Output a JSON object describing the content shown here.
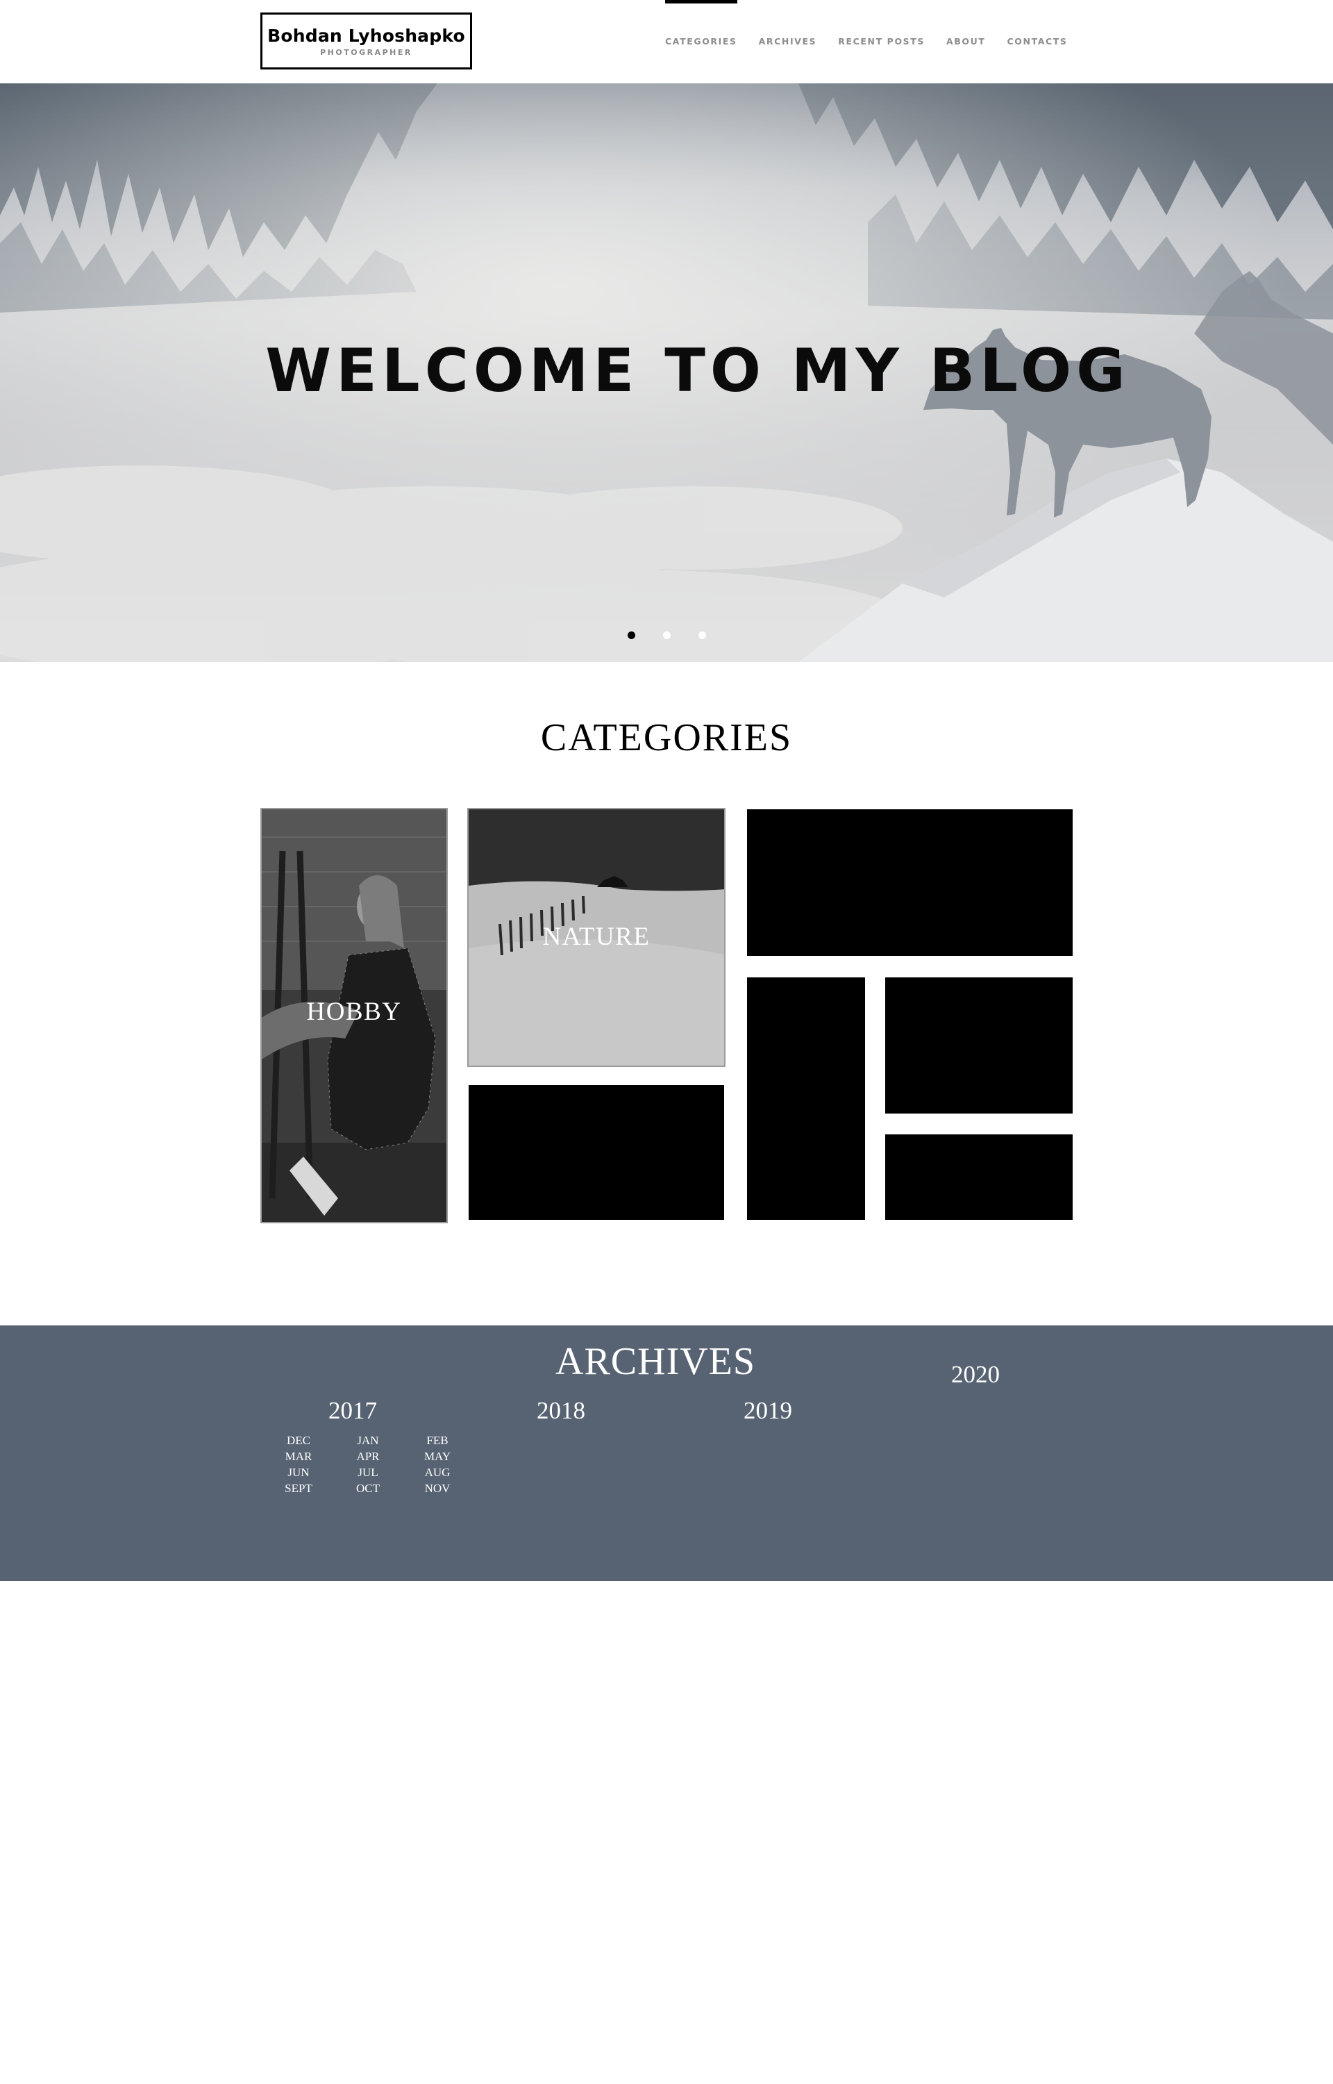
{
  "header": {
    "logo_name": "Bohdan Lyhoshapko",
    "logo_tagline": "PHOTOGRAPHER",
    "nav": [
      "CATEGORIES",
      "ARCHIVES",
      "RECENT POSTS",
      "ABOUT",
      "CONTACTS"
    ],
    "active_nav": "CATEGORIES"
  },
  "hero": {
    "title": "WELCOME TO MY BLOG",
    "slides_count": 3,
    "active_slide": 1
  },
  "categories": {
    "heading": "CATEGORIES",
    "tiles": [
      {
        "label": "HOBBY"
      },
      {
        "label": "NATURE"
      },
      {
        "label": ""
      },
      {
        "label": ""
      },
      {
        "label": ""
      },
      {
        "label": ""
      },
      {
        "label": ""
      }
    ]
  },
  "archives": {
    "heading": "ARCHIVES",
    "years": [
      "2017",
      "2018",
      "2019",
      "2020"
    ],
    "months_2017": [
      "DEC",
      "JAN",
      "FEB",
      "MAR",
      "APR",
      "MAY",
      "JUN",
      "JUL",
      "AUG",
      "SEPT",
      "OCT",
      "NOV"
    ]
  },
  "colors": {
    "archives_bg": "#576373",
    "accent": "#000000"
  }
}
